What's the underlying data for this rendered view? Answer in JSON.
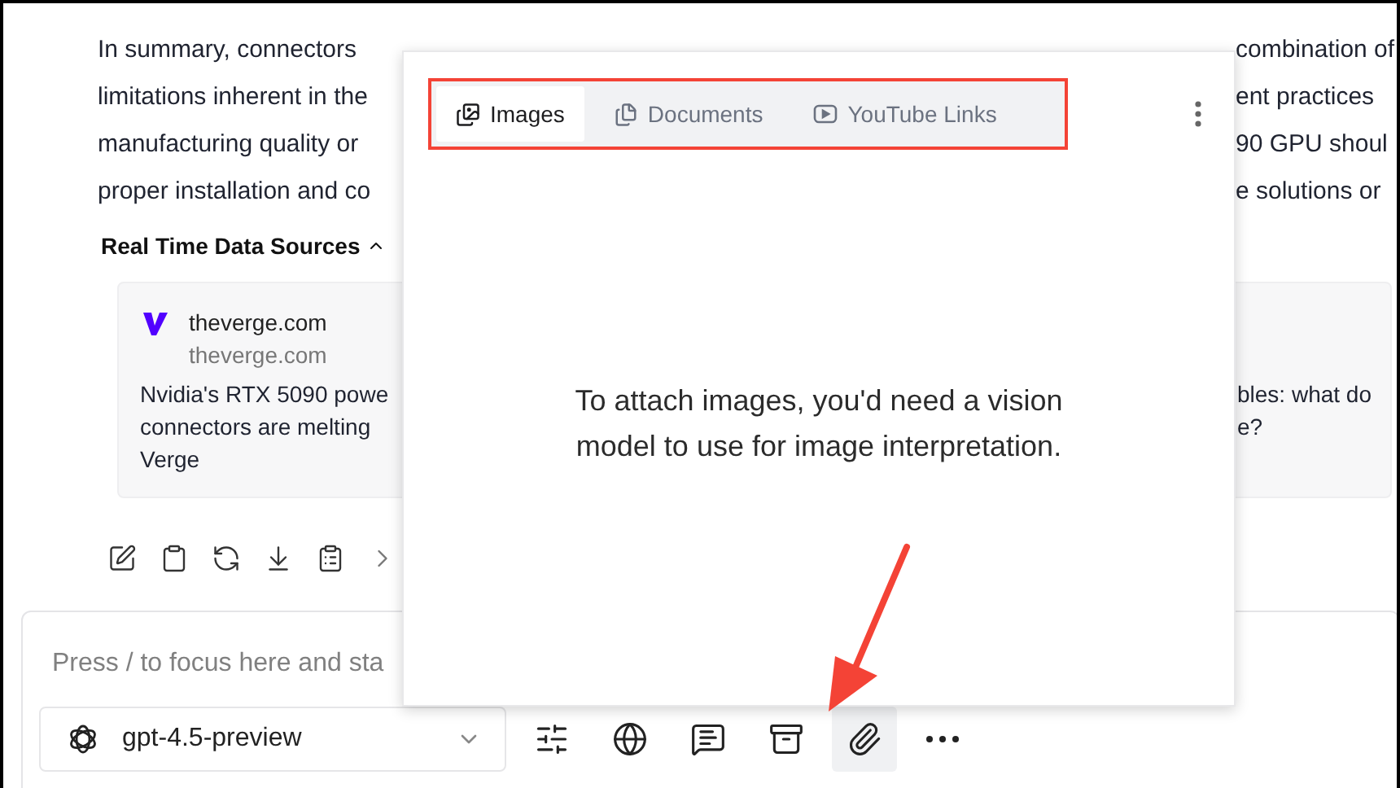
{
  "paragraph_lines": [
    {
      "left": "In summary, connectors",
      "right": "combination of"
    },
    {
      "left": "limitations inherent in the",
      "right": "ent practices"
    },
    {
      "left": "manufacturing quality or",
      "right": "90 GPU shoul"
    },
    {
      "left": "proper installation and co",
      "right": "e solutions or"
    }
  ],
  "sources": {
    "title": "Real Time Data Sources",
    "expanded": true,
    "cards": [
      {
        "site": "theverge.com",
        "domain": "theverge.com",
        "title_left": [
          "Nvidia's RTX 5090 powe",
          "connectors are melting",
          "Verge"
        ],
        "title_right": [
          "bles: what do",
          "e?"
        ]
      }
    ]
  },
  "composer": {
    "placeholder": "Press / to focus here and sta",
    "model": "gpt-4.5-preview",
    "tools": [
      {
        "kind": "sliders",
        "selected": false
      },
      {
        "kind": "web",
        "selected": false
      },
      {
        "kind": "prompts",
        "selected": false
      },
      {
        "kind": "library",
        "selected": false
      },
      {
        "kind": "attach",
        "selected": true
      },
      {
        "kind": "more",
        "selected": false
      }
    ]
  },
  "popup": {
    "tabs": [
      {
        "kind": "images",
        "label": "Images",
        "selected": true
      },
      {
        "kind": "documents",
        "label": "Documents",
        "selected": false
      },
      {
        "kind": "youtube",
        "label": "YouTube Links",
        "selected": false
      }
    ],
    "message": "To attach images, you'd need a vision model to use for image interpretation."
  }
}
